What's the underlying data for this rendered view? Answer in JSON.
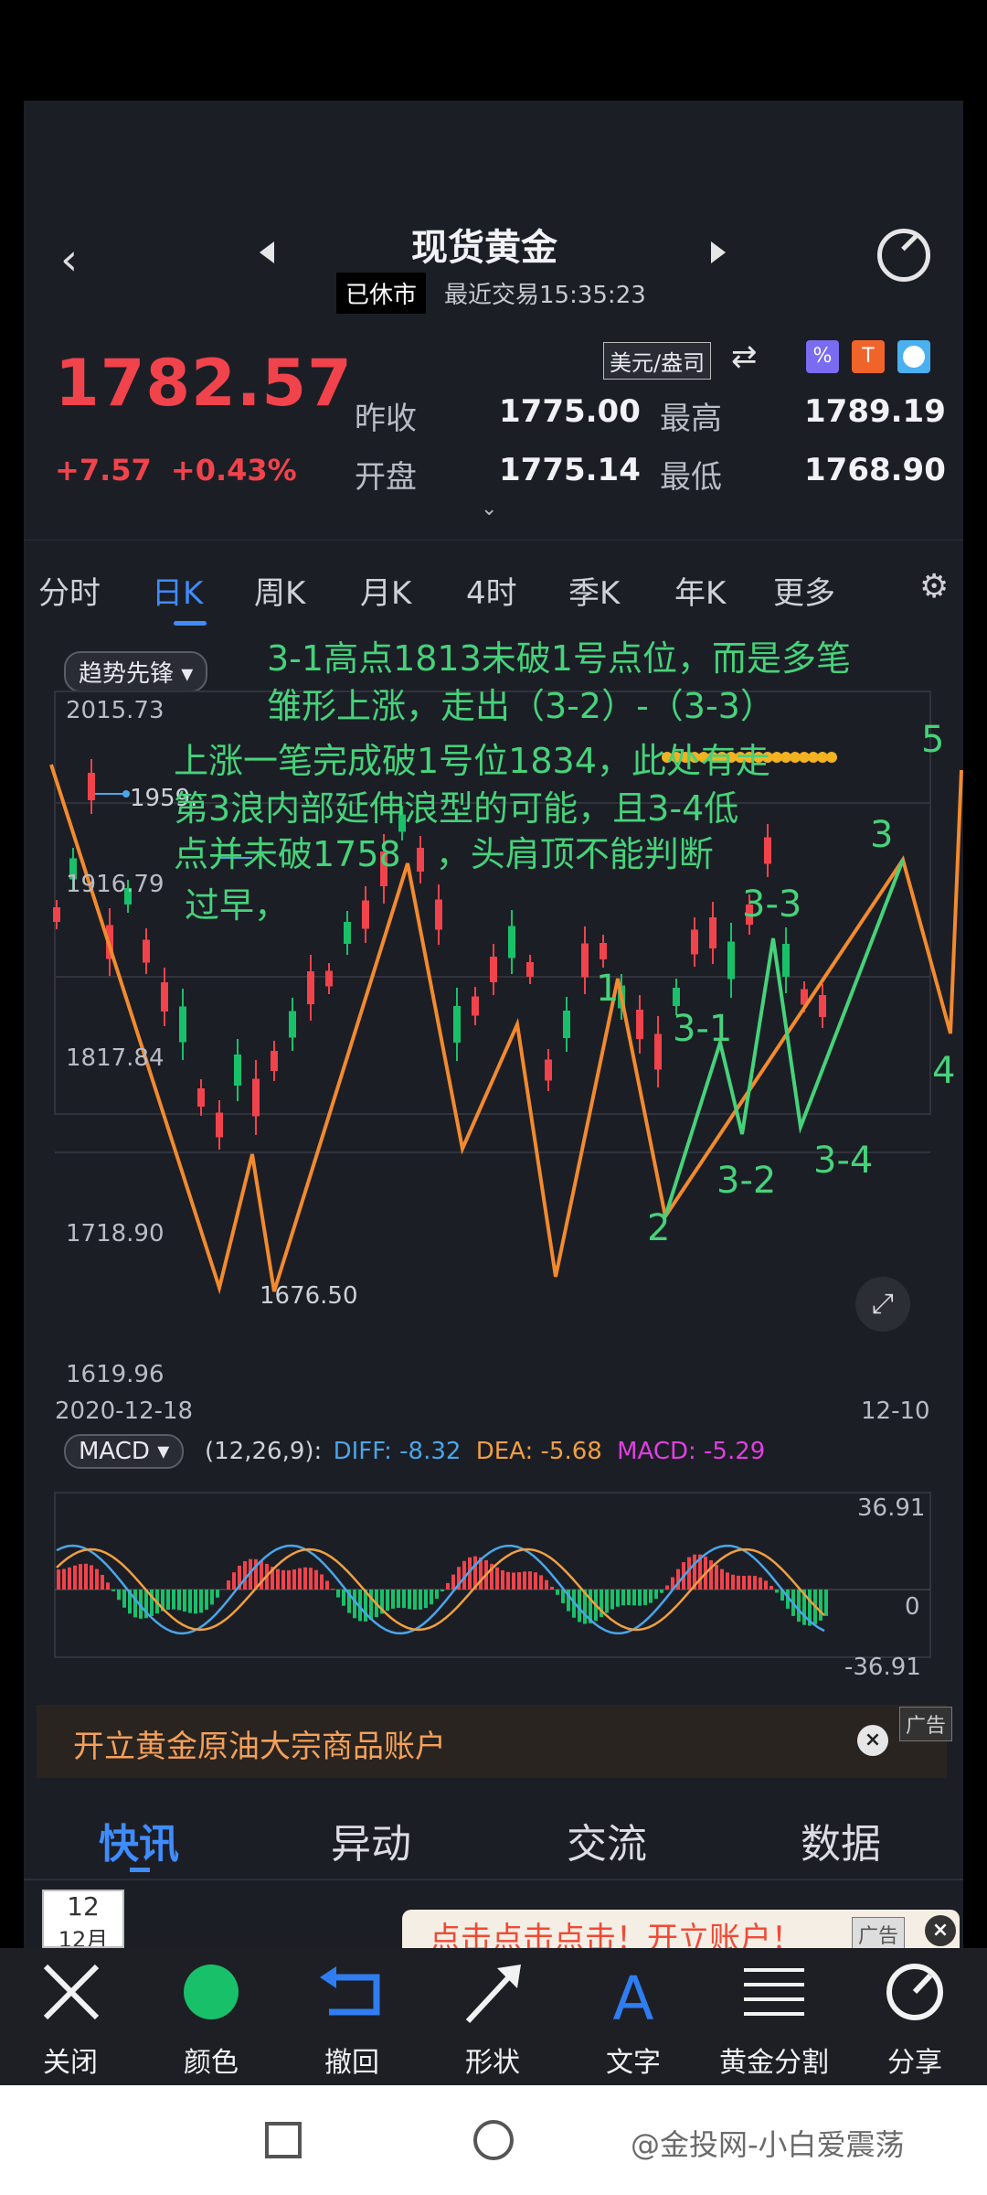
{
  "header": {
    "title": "现货黄金",
    "status": "已休市",
    "last_trade": "最近交易15:35:23"
  },
  "quote": {
    "price": "1782.57",
    "change": "+7.57",
    "change_pct": "+0.43%",
    "unit": "美元/盎司",
    "prev_close_label": "昨收",
    "prev_close": "1775.00",
    "high_label": "最高",
    "high": "1789.19",
    "open_label": "开盘",
    "open": "1775.14",
    "low_label": "最低",
    "low": "1768.90"
  },
  "tabs": [
    "分时",
    "日K",
    "周K",
    "月K",
    "4时",
    "季K",
    "年K",
    "更多"
  ],
  "active_tab": "日K",
  "chart": {
    "indicator_chip": "趋势先锋",
    "y_ticks": [
      "2015.73",
      "1916.79",
      "1817.84",
      "1718.90",
      "1619.96"
    ],
    "max_marker": "1959.",
    "min_marker": "1676.50",
    "start_date": "2020-12-18",
    "end_date": "12-10",
    "macd_chip": "MACD",
    "macd_params": "(12,26,9):",
    "diff": "DIFF: -8.32",
    "dea": "DEA: -5.68",
    "macd": "MACD: -5.29",
    "macd_ticks": [
      "36.91",
      "0",
      "-36.91"
    ],
    "colors": {
      "up": "#f0434b",
      "down": "#19c06a",
      "diff": "#4aa6e8",
      "dea": "#f0a040",
      "macd": "#e040e0",
      "annot": "#46d27a",
      "wave": "#f28a2e"
    }
  },
  "annotation": {
    "line1": "3-1高点1813未破1号点位，而是多笔",
    "line2": "雏形上涨，走出（3-2）-（3-3）",
    "line3": "上涨一笔完成破1号位1834，此处有走",
    "line4": "第3浪内部延伸浪型的可能，且3-4低",
    "line5": "点并未破1758　，头肩顶不能判断",
    "line6": "过早，"
  },
  "waves": {
    "w1": "1",
    "w2": "2",
    "w31": "3-1",
    "w32": "3-2",
    "w33": "3-3",
    "w34": "3-4",
    "w3": "3",
    "w4": "4",
    "w5": "5"
  },
  "ad1": {
    "text": "开立黄金原油大宗商品账户",
    "tag": "广告"
  },
  "news_tabs": [
    "快讯",
    "异动",
    "交流",
    "数据"
  ],
  "news_date": {
    "day": "12",
    "month": "12月"
  },
  "ad2": {
    "text": "点击点击点击！开立账户！",
    "tag": "广告"
  },
  "toolbar": [
    "关闭",
    "颜色",
    "撤回",
    "形状",
    "文字",
    "黄金分割",
    "分享"
  ],
  "watermark": "@金投网-小白爱震荡"
}
